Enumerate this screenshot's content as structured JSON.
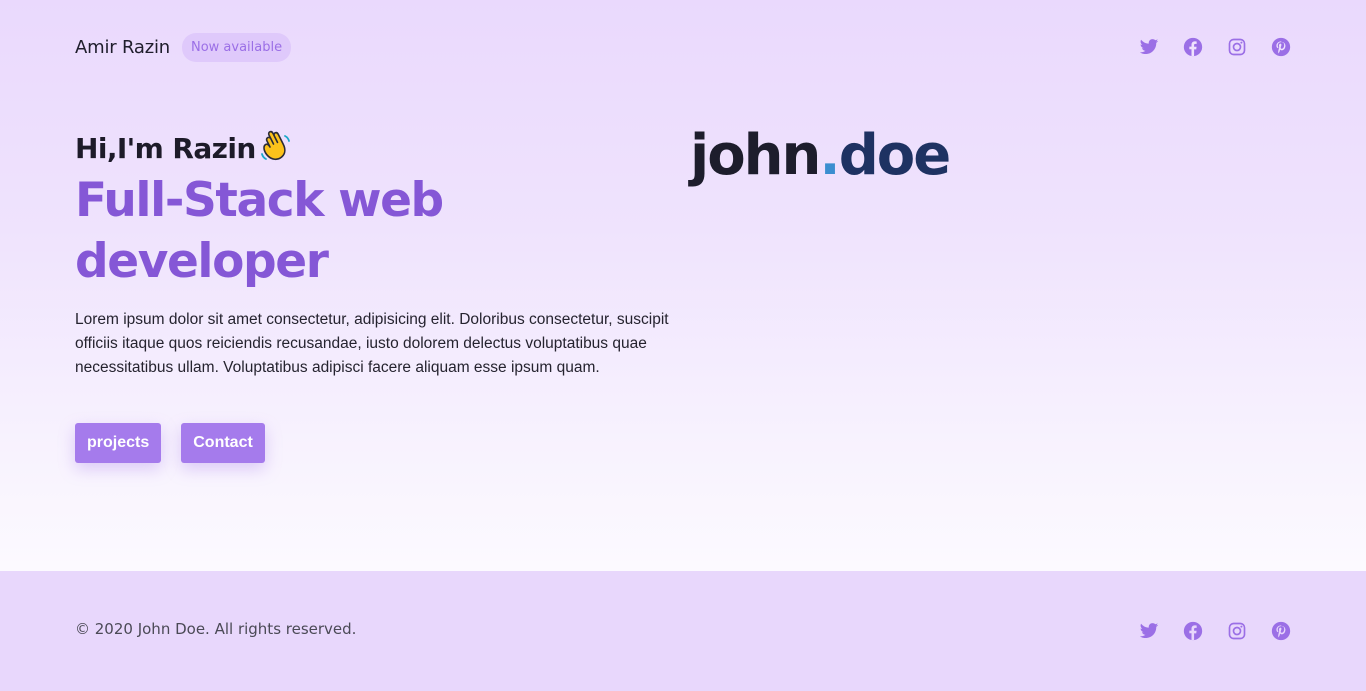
{
  "header": {
    "brand_name": "Amir Razin",
    "badge": "Now available",
    "socials": [
      "twitter-icon",
      "facebook-icon",
      "instagram-icon",
      "pinterest-icon"
    ]
  },
  "hero": {
    "greeting": "Hi,I'm Razin",
    "greeting_emoji": "waving-hand-icon",
    "headline": "Full-Stack web developer",
    "description": "Lorem ipsum dolor sit amet consectetur, adipisicing elit. Doloribus consectetur, suscipit officiis itaque quos reiciendis recusandae, iusto dolorem delectus voluptatibus quae necessitatibus ullam. Voluptatibus adipisci facere aliquam esse ipsum quam.",
    "buttons": {
      "projects": "projects",
      "contact": "Contact"
    }
  },
  "logo": {
    "part1": "john",
    "dot": ".",
    "part2": "doe"
  },
  "footer": {
    "copyright": "© 2020 John Doe. All rights reserved."
  },
  "colors": {
    "accent": "#8557d6",
    "button": "#a57bec",
    "icon": "#9b6fe6",
    "footer_bg": "#e8d7fc"
  }
}
